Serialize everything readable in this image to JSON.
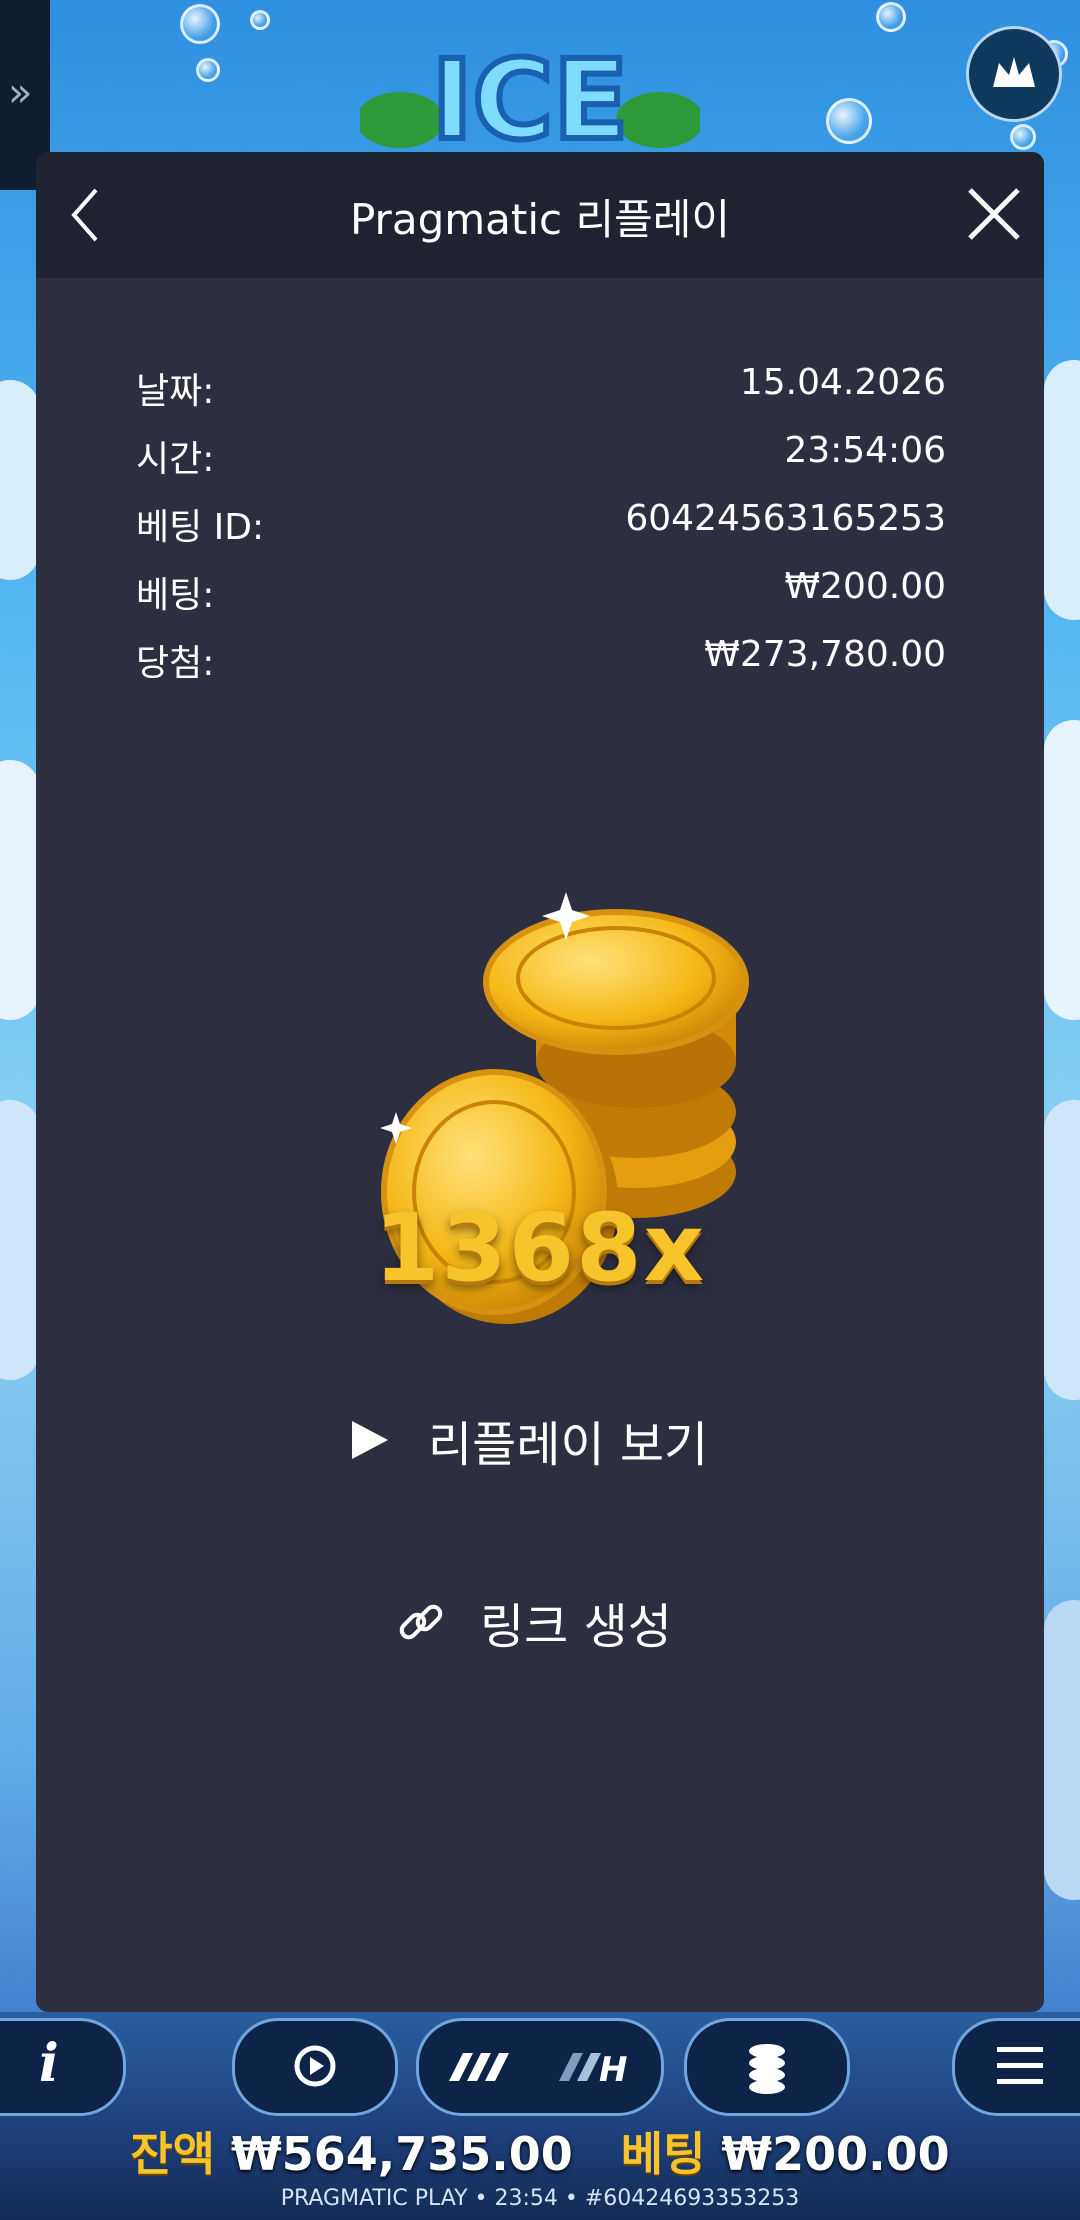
{
  "modal": {
    "title": "Pragmatic 리플레이",
    "rows": [
      {
        "label": "날짜:",
        "value": "15.04.2026"
      },
      {
        "label": "시간:",
        "value": "23:54:06"
      },
      {
        "label": "베팅 ID:",
        "value": "60424563165253"
      },
      {
        "label": "베팅:",
        "value": "₩200.00"
      },
      {
        "label": "당첨:",
        "value": "₩273,780.00"
      }
    ],
    "multiplier": "1368x",
    "replay_label": "리플레이 보기",
    "link_label": "링크 생성"
  },
  "game": {
    "logo_text": "ICE"
  },
  "bottom": {
    "balance_label": "잔액",
    "balance_value": "₩564,735.00",
    "bet_label": "베팅",
    "bet_value": "₩200.00",
    "footer": "PRAGMATIC PLAY • 23:54 • #60424693353253"
  },
  "icons": {
    "side_menu": "double-chevron-right-icon",
    "crown": "crown-icon",
    "back": "chevron-left-icon",
    "close": "close-icon",
    "coins": "gold-coins-icon",
    "play": "play-icon",
    "link": "link-icon",
    "info": "info-icon",
    "autoplay": "autoplay-icon",
    "turbo": "turbo-speed-icon",
    "bet": "coin-stack-icon",
    "menu": "hamburger-menu-icon"
  },
  "colors": {
    "modal_bg": "#2d2f40",
    "header_bg": "#1f2230",
    "accent_gold": "#f7c52b"
  }
}
